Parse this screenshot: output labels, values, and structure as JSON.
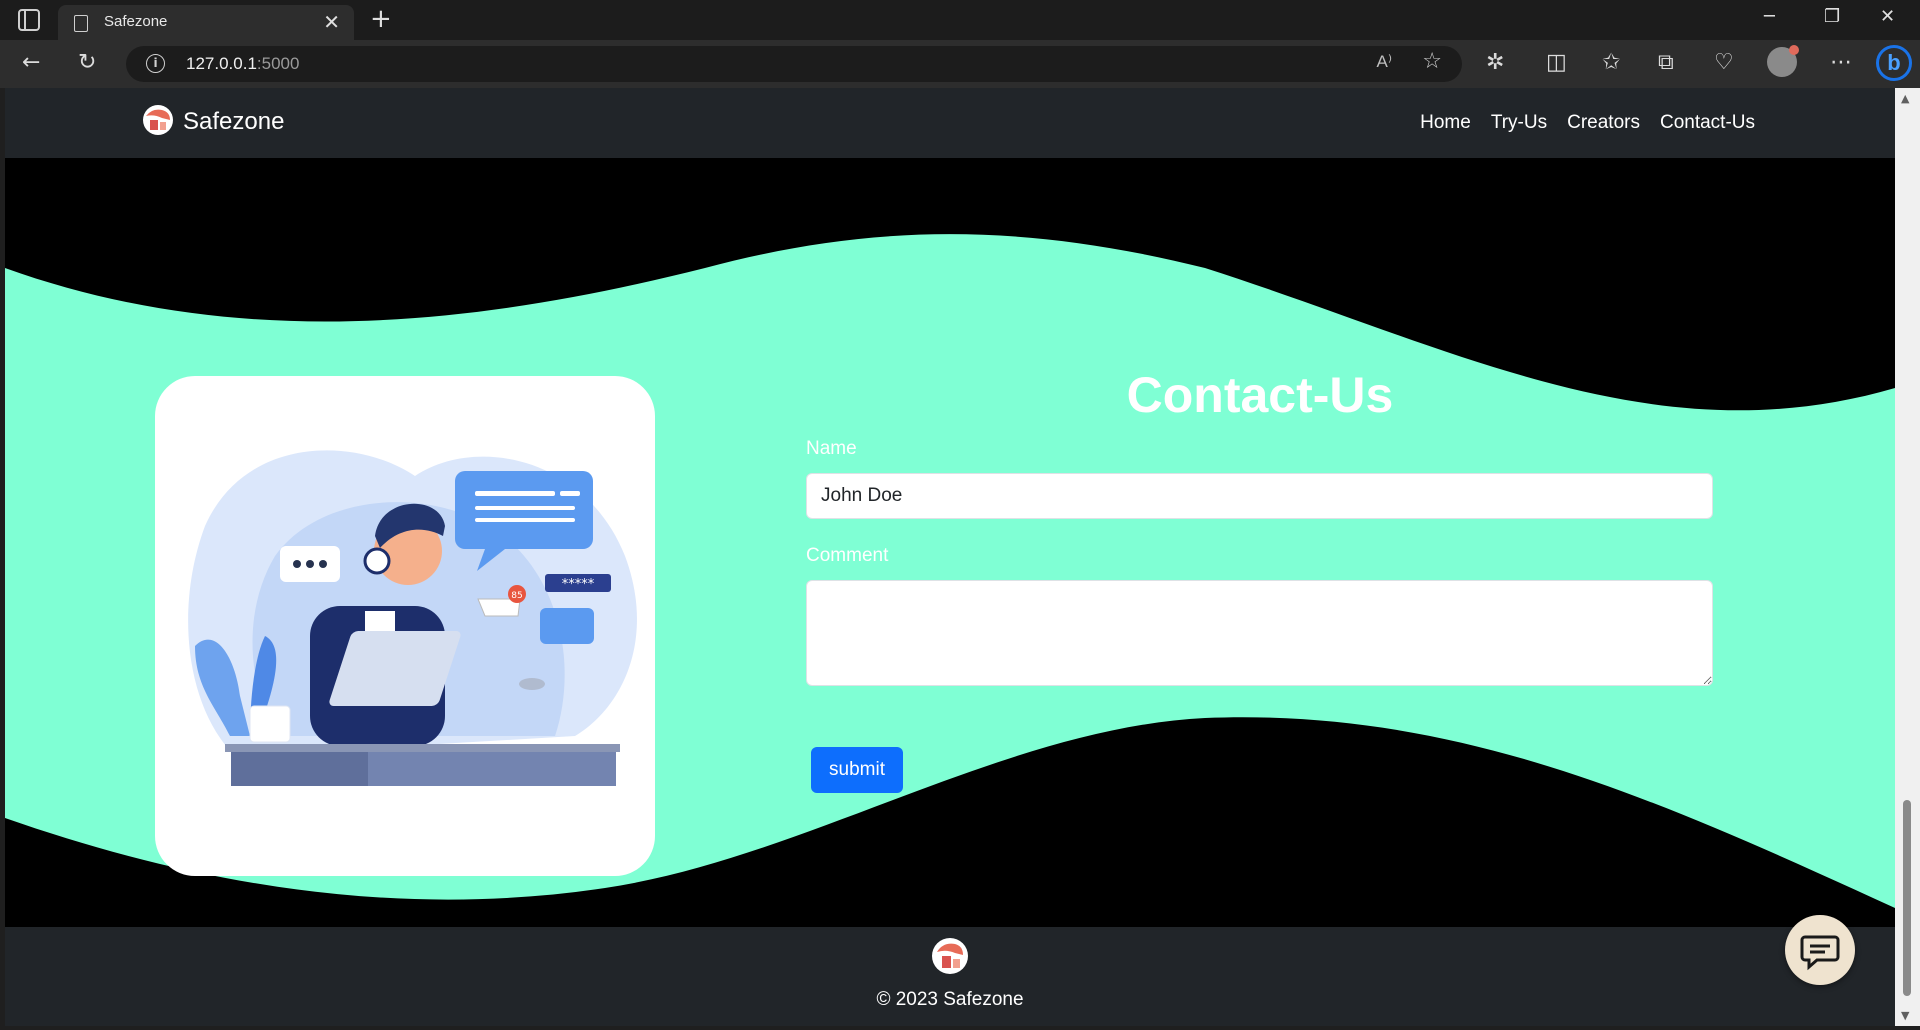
{
  "browser": {
    "tab_title": "Safezone",
    "tab_close": "✕",
    "new_tab": "+",
    "url_host": "127.0.0.1",
    "url_port": ":5000",
    "read_aloud": "A⁾",
    "window_controls": {
      "minimize": "─",
      "restore": "❐",
      "close": "✕"
    }
  },
  "navbar": {
    "brand": "Safezone",
    "links": [
      {
        "label": "Home"
      },
      {
        "label": "Try-Us"
      },
      {
        "label": "Creators"
      },
      {
        "label": "Contact-Us"
      }
    ]
  },
  "contact": {
    "title": "Contact-Us",
    "name_label": "Name",
    "name_value": "John Doe",
    "comment_label": "Comment",
    "comment_value": "",
    "submit_label": "submit"
  },
  "footer": {
    "copyright": "© 2023 Safezone"
  },
  "colors": {
    "wave": "#7fffd4",
    "navbar": "#212529",
    "button": "#0d6efd"
  }
}
